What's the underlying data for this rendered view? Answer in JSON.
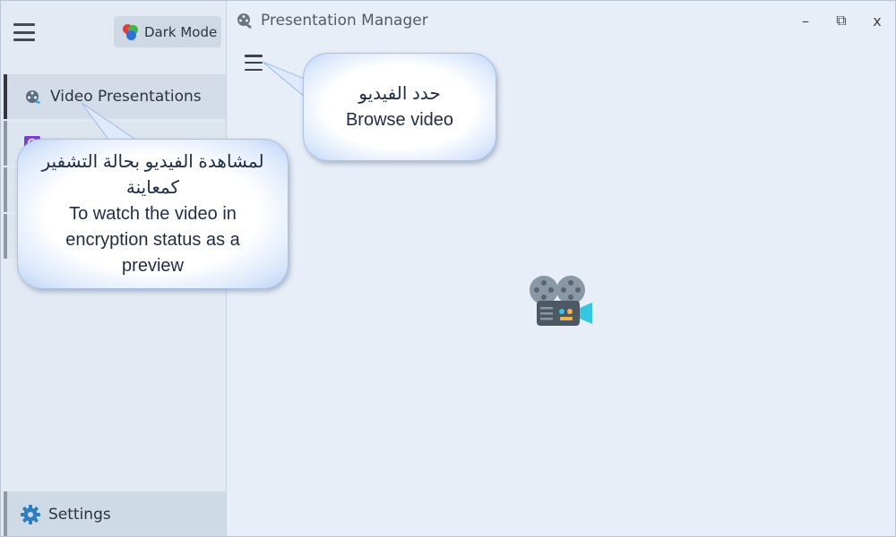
{
  "sidebar": {
    "dark_mode_label": "Dark Mode",
    "items": [
      {
        "label": "Video Presentations",
        "icon": "film-reel-icon"
      },
      {
        "label": "",
        "icon": "gear-target-icon"
      },
      {
        "label": ""
      },
      {
        "label": ""
      }
    ],
    "settings_label": "Settings"
  },
  "titlebar": {
    "title": "Presentation Manager",
    "minimize": "–",
    "restore": "⧉",
    "close": "x"
  },
  "tooltips": {
    "browse": {
      "arabic": "حدد الفيديو",
      "english": "Browse video"
    },
    "preview": {
      "arabic": "لمشاهدة الفيديو بحالة التشفير كمعاينة",
      "english": "To watch the video in encryption status as a preview"
    }
  },
  "colors": {
    "sidebar_bg": "#e3eaf3",
    "main_bg": "#e8eef8",
    "gear": "#2f7fbf",
    "bubble_border": "#a9c1e8"
  }
}
